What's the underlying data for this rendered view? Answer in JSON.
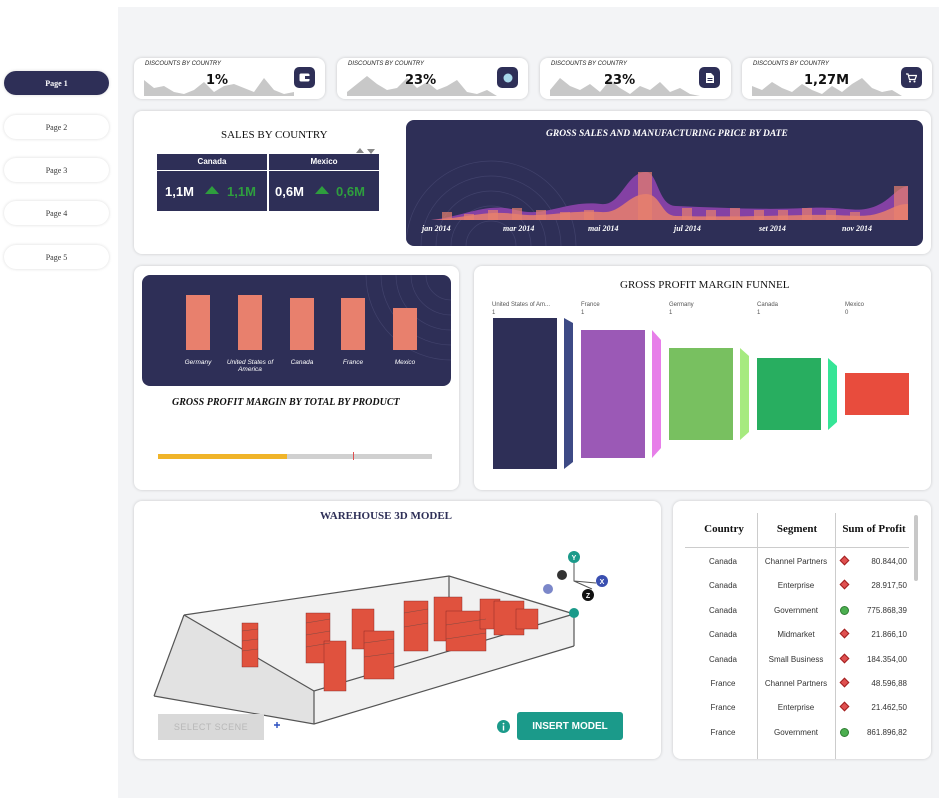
{
  "sidebar": {
    "pages": [
      "Page 1",
      "Page 2",
      "Page 3",
      "Page 4",
      "Page 5"
    ]
  },
  "kpis": [
    {
      "title": "DISCOUNTS BY COUNTRY",
      "value": "1%",
      "icon": "wallet-icon"
    },
    {
      "title": "DISCOUNTS BY COUNTRY",
      "value": "23%",
      "icon": "coin-icon"
    },
    {
      "title": "DISCOUNTS BY COUNTRY",
      "value": "23%",
      "icon": "document-icon"
    },
    {
      "title": "DISCOUNTS BY COUNTRY",
      "value": "1,27M",
      "icon": "cart-icon"
    }
  ],
  "sales_by_country": {
    "title": "SALES BY COUNTRY",
    "columns": [
      {
        "country": "Canada",
        "value": "1,1M",
        "target": "1,1M"
      },
      {
        "country": "Mexico",
        "value": "0,6M",
        "target": "0,6M"
      }
    ]
  },
  "gross_sales": {
    "title": "GROSS SALES AND MANUFACTURING PRICE BY DATE",
    "months": [
      "jan 2014",
      "mar 2014",
      "mai 2014",
      "jul 2014",
      "set 2014",
      "nov 2014"
    ]
  },
  "gross_profit_product": {
    "title": "GROSS PROFIT MARGIN BY TOTAL BY PRODUCT",
    "categories": [
      "Germany",
      "United States of America",
      "Canada",
      "France",
      "Mexico"
    ],
    "progress": 0.47
  },
  "funnel": {
    "title": "GROSS PROFIT MARGIN FUNNEL",
    "stages": [
      {
        "label": "United States of Am...",
        "value": "1",
        "color": "#2e2f57",
        "accent": "#3d4a85"
      },
      {
        "label": "France",
        "value": "1",
        "color": "#9b59b6",
        "accent": "#e77fe9"
      },
      {
        "label": "Germany",
        "value": "1",
        "color": "#78c060",
        "accent": "#a6ea7f"
      },
      {
        "label": "Canada",
        "value": "1",
        "color": "#28ae60",
        "accent": "#35e596"
      },
      {
        "label": "Mexico",
        "value": "0",
        "color": "#e84c3d",
        "accent": ""
      }
    ]
  },
  "warehouse": {
    "title": "WAREHOUSE 3D MODEL",
    "select_scene": "SELECT SCENE",
    "insert_model": "INSERT MODEL",
    "axes": [
      "Y",
      "X",
      "Z"
    ]
  },
  "profit_table": {
    "headers": [
      "Country",
      "Segment",
      "Sum of Profit"
    ],
    "rows": [
      {
        "country": "Canada",
        "segment": "Channel Partners",
        "profit": "80.844,00",
        "status": "red"
      },
      {
        "country": "Canada",
        "segment": "Enterprise",
        "profit": "28.917,50",
        "status": "red"
      },
      {
        "country": "Canada",
        "segment": "Government",
        "profit": "775.868,39",
        "status": "green"
      },
      {
        "country": "Canada",
        "segment": "Midmarket",
        "profit": "21.866,10",
        "status": "red"
      },
      {
        "country": "Canada",
        "segment": "Small Business",
        "profit": "184.354,00",
        "status": "red"
      },
      {
        "country": "France",
        "segment": "Channel Partners",
        "profit": "48.596,88",
        "status": "red"
      },
      {
        "country": "France",
        "segment": "Enterprise",
        "profit": "21.462,50",
        "status": "red"
      },
      {
        "country": "France",
        "segment": "Government",
        "profit": "861.896,82",
        "status": "green"
      }
    ]
  },
  "colors": {
    "navy": "#2e2f57",
    "salmon": "#e8806d",
    "teal": "#1b9a8a",
    "green": "#2e9e3e",
    "red": "#e05050"
  }
}
